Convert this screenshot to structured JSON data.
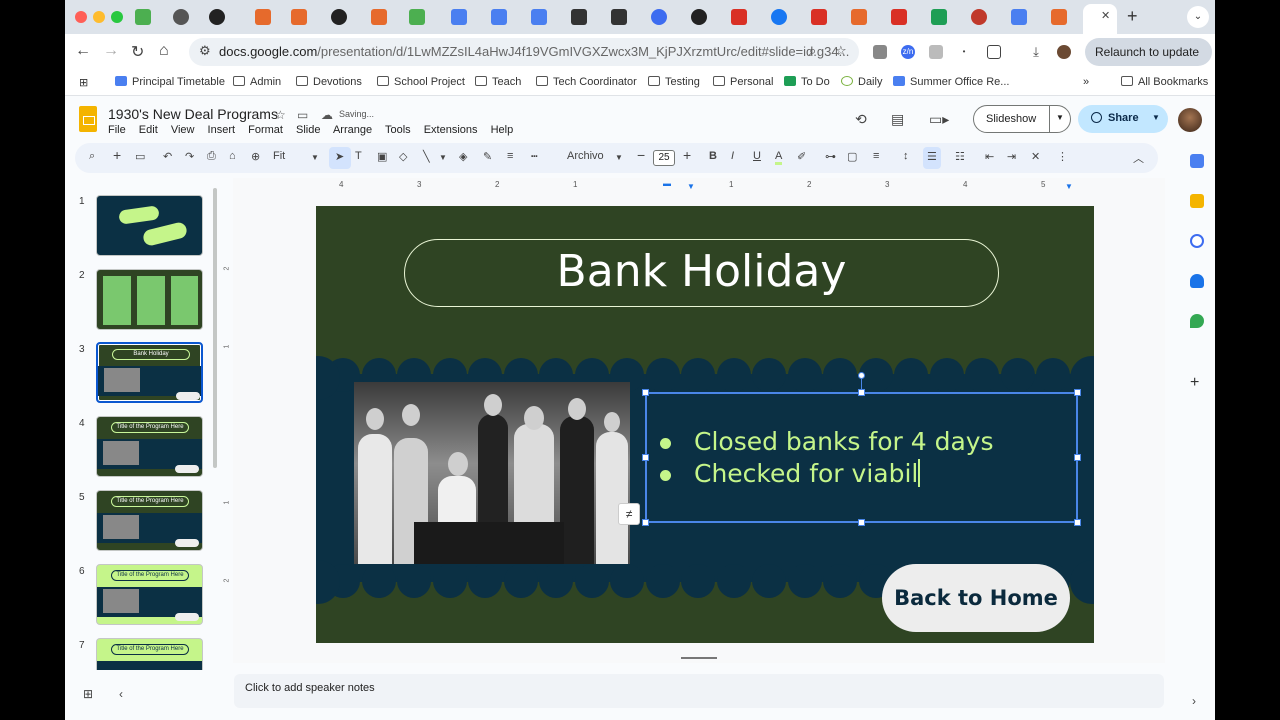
{
  "browser": {
    "relaunch_label": "Relaunch to update",
    "url_main": "docs.google.com",
    "url_rest": "/presentation/d/1LwMZZsIL4aHwJ4f19VGmIVGXZwcx3M_KjPJXrzmtUrc/edit#slide=id.g34...",
    "bookmarks": [
      "Principal Timetable",
      "Admin",
      "Devotions",
      "School Project",
      "Teach",
      "Tech Coordinator",
      "Testing",
      "Personal",
      "To Do",
      "Daily",
      "Summer Office Re..."
    ],
    "all_bookmarks": "All Bookmarks"
  },
  "doc": {
    "title": "1930's New Deal Programs",
    "saving": "Saving...",
    "menu": [
      "File",
      "Edit",
      "View",
      "Insert",
      "Format",
      "Slide",
      "Arrange",
      "Tools",
      "Extensions",
      "Help"
    ],
    "slideshow_label": "Slideshow",
    "share_label": "Share"
  },
  "toolbar": {
    "zoom": "Fit",
    "font": "Archivo",
    "font_size": "25"
  },
  "filmstrip": {
    "numbers": [
      "1",
      "2",
      "3",
      "4",
      "5",
      "6",
      "7"
    ],
    "titles": [
      "",
      "",
      "Bank Holiday",
      "Title of the Program Here",
      "Title of the Program Here",
      "Title of the Program Here",
      "Title of the Program Here"
    ]
  },
  "slide": {
    "title": "Bank Holiday",
    "bullets": [
      "Closed banks for 4 days",
      "Checked for viabil"
    ],
    "home_button": "Back to Home",
    "colors": {
      "background": "#2f4423",
      "band": "#0b3044",
      "accent": "#c5f58a"
    }
  },
  "ruler": {
    "h": [
      "4",
      "3",
      "2",
      "1",
      "1",
      "2",
      "3",
      "4",
      "5"
    ],
    "v": [
      "2",
      "1",
      "1",
      "2"
    ]
  },
  "notes_placeholder": "Click to add speaker notes"
}
